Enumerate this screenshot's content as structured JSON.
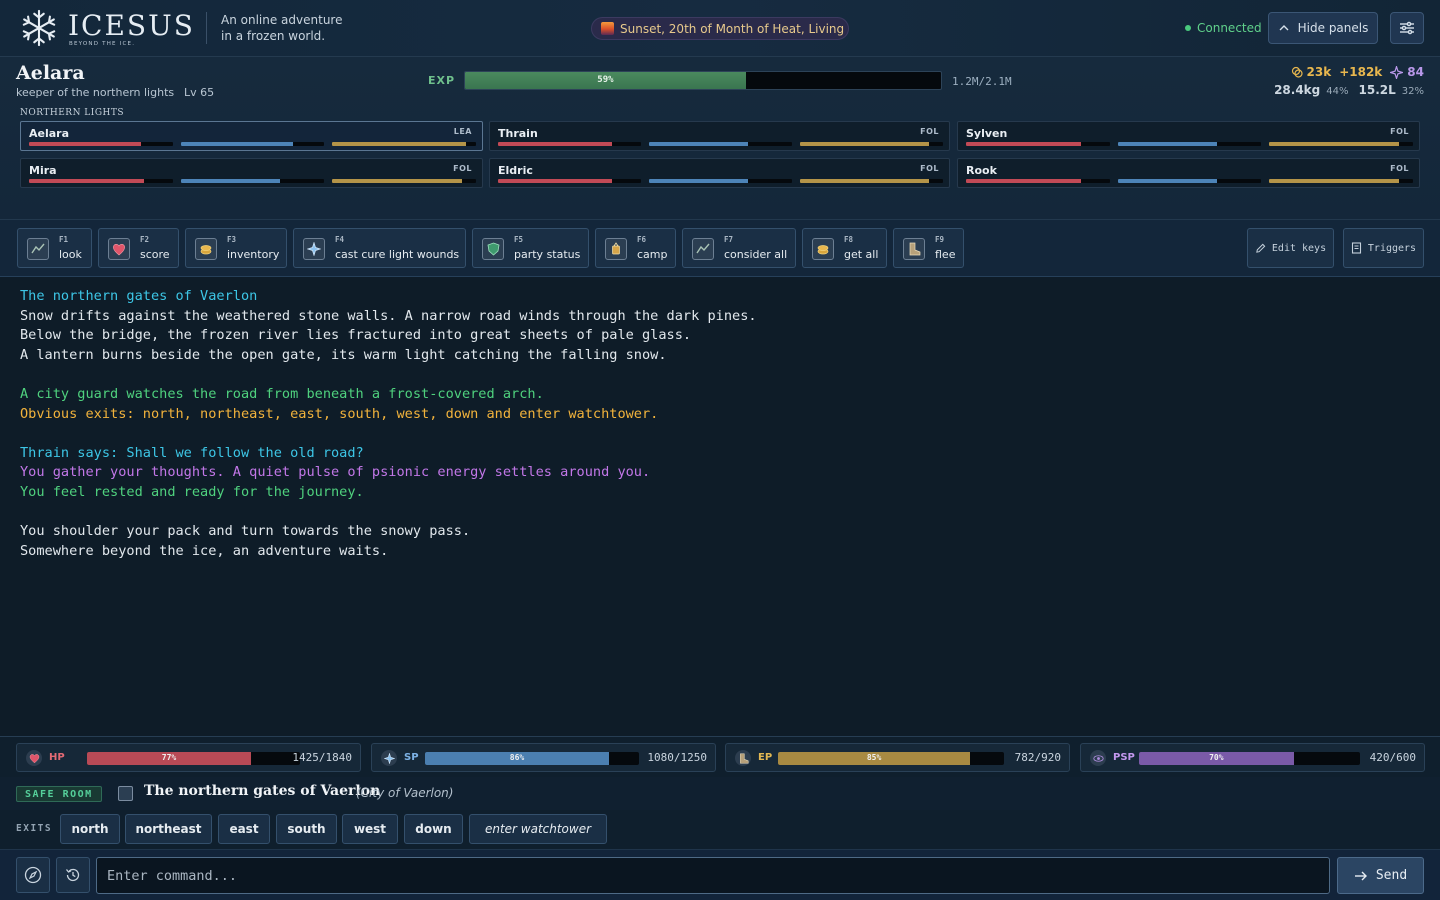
{
  "header": {
    "logo_text": "ICESUS",
    "logo_sub": "BEYOND THE ICE.",
    "tagline": "An online adventure in a frozen world.",
    "date": "Sunset, 20th of Month of Heat, Living",
    "status": "Connected",
    "hide_panels": "Hide panels"
  },
  "character": {
    "name": "Aelara",
    "title": "keeper of the northern lights",
    "level": "Lv 65",
    "exp_label": "EXP",
    "exp_percent": 59,
    "exp_percent_text": "59%",
    "exp_value": "1.2M/2.1M",
    "gold": "23k",
    "gold_delta": "+182k",
    "psi_points": "84",
    "weight": "28.4kg",
    "weight_pct": "44%",
    "volume": "15.2L",
    "volume_pct": "32%"
  },
  "party": {
    "name": "NORTHERN LIGHTS",
    "members": [
      {
        "name": "Aelara",
        "role": "LEA",
        "hp": 0.78,
        "sp": 0.78,
        "ep": 0.93
      },
      {
        "name": "Thrain",
        "role": "FOL",
        "hp": 0.8,
        "sp": 0.69,
        "ep": 0.9
      },
      {
        "name": "Sylven",
        "role": "FOL",
        "hp": 0.8,
        "sp": 0.69,
        "ep": 0.9
      },
      {
        "name": "Mira",
        "role": "FOL",
        "hp": 0.8,
        "sp": 0.69,
        "ep": 0.9
      },
      {
        "name": "Eldric",
        "role": "FOL",
        "hp": 0.8,
        "sp": 0.69,
        "ep": 0.9
      },
      {
        "name": "Rook",
        "role": "FOL",
        "hp": 0.8,
        "sp": 0.69,
        "ep": 0.9
      }
    ]
  },
  "hotkeys": [
    {
      "key": "F1",
      "label": "look",
      "icon": "map-icon"
    },
    {
      "key": "F2",
      "label": "score",
      "icon": "heart-icon"
    },
    {
      "key": "F3",
      "label": "inventory",
      "icon": "coins-icon"
    },
    {
      "key": "F4",
      "label": "cast cure light wounds",
      "icon": "sparkle-icon"
    },
    {
      "key": "F5",
      "label": "party status",
      "icon": "shield-icon"
    },
    {
      "key": "F6",
      "label": "camp",
      "icon": "lantern-icon"
    },
    {
      "key": "F7",
      "label": "consider all",
      "icon": "map-icon"
    },
    {
      "key": "F8",
      "label": "get all",
      "icon": "coins-icon"
    },
    {
      "key": "F9",
      "label": "flee",
      "icon": "boot-icon"
    }
  ],
  "tools": {
    "edit_keys": "Edit keys",
    "triggers": "Triggers"
  },
  "output": [
    {
      "text": "The northern gates of Vaerlon",
      "color": "cyan"
    },
    {
      "text": "Snow drifts against the weathered stone walls. A narrow road winds through the dark pines.",
      "color": "white"
    },
    {
      "text": "Below the bridge, the frozen river lies fractured into great sheets of pale glass.",
      "color": "white"
    },
    {
      "text": "A lantern burns beside the open gate, its warm light catching the falling snow.",
      "color": "white"
    },
    {
      "text": "",
      "color": "white"
    },
    {
      "text": "A city guard watches the road from beneath a frost-covered arch.",
      "color": "green"
    },
    {
      "text": "Obvious exits: north, northeast, east, south, west, down and enter watchtower.",
      "color": "orange"
    },
    {
      "text": "",
      "color": "white"
    },
    {
      "text": "Thrain says: Shall we follow the old road?",
      "color": "cyan"
    },
    {
      "text": "You gather your thoughts. A quiet pulse of psionic energy settles around you.",
      "color": "purple"
    },
    {
      "text": "You feel rested and ready for the journey.",
      "color": "green"
    },
    {
      "text": "",
      "color": "white"
    },
    {
      "text": "You shoulder your pack and turn towards the snowy pass.",
      "color": "white"
    },
    {
      "text": "Somewhere beyond the ice, an adventure waits.",
      "color": "white"
    }
  ],
  "vitals": [
    {
      "label": "HP",
      "percent": 77,
      "percent_text": "77%",
      "value": "1425/1840",
      "color": "#b84a56",
      "label_color": "#e36a74",
      "icon": "heart-icon"
    },
    {
      "label": "SP",
      "percent": 86,
      "percent_text": "86%",
      "value": "1080/1250",
      "color": "#4b7fb0",
      "label_color": "#7db2e6",
      "icon": "sparkle-icon"
    },
    {
      "label": "EP",
      "percent": 85,
      "percent_text": "85%",
      "value": "782/920",
      "color": "#a88a42",
      "label_color": "#e2b852",
      "icon": "boot-icon"
    },
    {
      "label": "PSP",
      "percent": 70,
      "percent_text": "70%",
      "value": "420/600",
      "color": "#7a5aa8",
      "label_color": "#c398ee",
      "icon": "eye-icon"
    }
  ],
  "room": {
    "safe_label": "SAFE ROOM",
    "name": "The northern gates of Vaerlon",
    "area": "(City of Vaerlon)"
  },
  "exits": {
    "label": "EXITS",
    "items": [
      "north",
      "northeast",
      "east",
      "south",
      "west",
      "down",
      "enter watchtower"
    ]
  },
  "input": {
    "placeholder": "Enter command...",
    "send_label": "Send"
  },
  "colors": {
    "hp": "#c24a56",
    "sp": "#4d84b8",
    "ep": "#b49448",
    "accent_green": "#4fd17e",
    "accent_cyan": "#3dc6e6"
  }
}
